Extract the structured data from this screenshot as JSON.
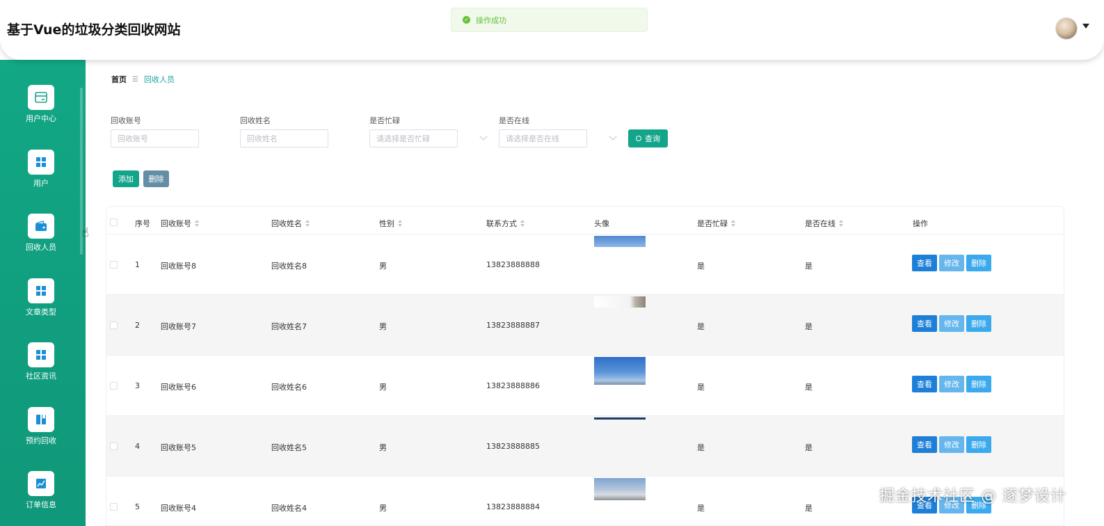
{
  "header": {
    "title": "基于Vue的垃圾分类回收网站"
  },
  "toast": {
    "icon": "check-circle-icon",
    "message": "操作成功",
    "color": "#67c23a"
  },
  "sidebar": {
    "items": [
      {
        "label": "用户中心",
        "icon": "card-icon"
      },
      {
        "label": "用户",
        "icon": "grid-icon"
      },
      {
        "label": "回收人员",
        "icon": "wallet-icon"
      },
      {
        "label": "文章类型",
        "icon": "grid-icon"
      },
      {
        "label": "社区资讯",
        "icon": "grid-icon"
      },
      {
        "label": "预约回收",
        "icon": "book-icon"
      },
      {
        "label": "订单信息",
        "icon": "chart-icon"
      }
    ]
  },
  "breadcrumb": {
    "home": "首页",
    "separator": "☰",
    "current": "回收人员"
  },
  "search": {
    "account_label": "回收账号",
    "account_placeholder": "回收账号",
    "name_label": "回收姓名",
    "name_placeholder": "回收姓名",
    "busy_label": "是否忙碌",
    "busy_placeholder": "请选择是否忙碌",
    "online_label": "是否在线",
    "online_placeholder": "请选择是否在线",
    "query_label": "查询"
  },
  "toolbar": {
    "add_label": "添加",
    "delete_label": "删除"
  },
  "table": {
    "columns": [
      "序号",
      "回收账号",
      "回收姓名",
      "性别",
      "联系方式",
      "头像",
      "是否忙碌",
      "是否在线",
      "操作"
    ],
    "actions": {
      "view": "查看",
      "edit": "修改",
      "delete": "删除"
    },
    "rows": [
      {
        "index": "1",
        "account": "回收账号8",
        "name": "回收姓名8",
        "gender": "男",
        "phone": "13823888888",
        "busy": "是",
        "online": "是"
      },
      {
        "index": "2",
        "account": "回收账号7",
        "name": "回收姓名7",
        "gender": "男",
        "phone": "13823888887",
        "busy": "是",
        "online": "是"
      },
      {
        "index": "3",
        "account": "回收账号6",
        "name": "回收姓名6",
        "gender": "男",
        "phone": "13823888886",
        "busy": "是",
        "online": "是"
      },
      {
        "index": "4",
        "account": "回收账号5",
        "name": "回收姓名5",
        "gender": "男",
        "phone": "13823888885",
        "busy": "是",
        "online": "是"
      },
      {
        "index": "5",
        "account": "回收账号4",
        "name": "回收姓名4",
        "gender": "男",
        "phone": "13823888884",
        "busy": "是",
        "online": "是"
      }
    ]
  },
  "watermark": "掘金技术社区 @ 逐梦设计",
  "colors": {
    "primary": "#13a58a",
    "view": "#1d7fd8",
    "edit": "#66b6ee",
    "delete": "#3aa9ee",
    "batch_delete": "#648ea6"
  }
}
